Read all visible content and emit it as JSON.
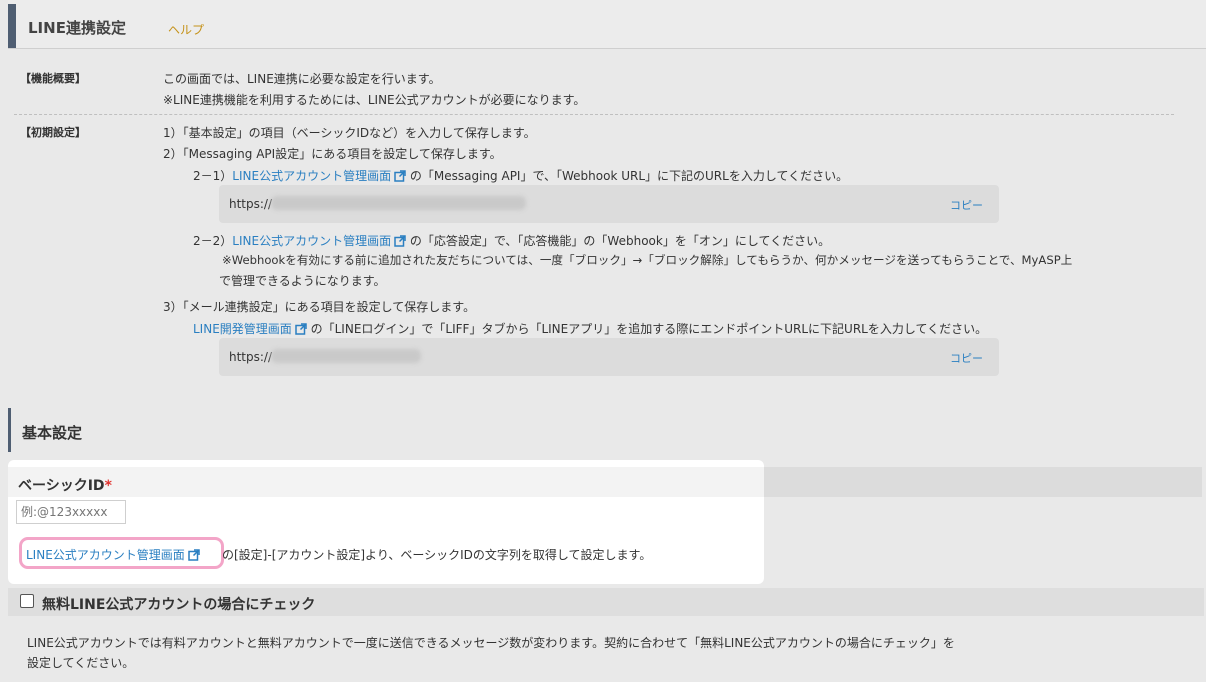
{
  "header": {
    "title": "LINE連携設定",
    "help": "ヘルプ"
  },
  "info": {
    "overview_label": "【機能概要】",
    "overview_lines": [
      "この画面では、LINE連携に必要な設定を行います。",
      "※LINE連携機能を利用するためには、LINE公式アカウントが必要になります。"
    ],
    "initial_label": "【初期設定】",
    "step1": "1）「基本設定」の項目（ベーシックIDなど）を入力して保存します。",
    "step2": "2）「Messaging API設定」にある項目を設定して保存します。",
    "step2_1_prefix": "2－1）",
    "step2_1_link": "LINE公式アカウント管理画面",
    "step2_1_text": "の「Messaging API」で、「Webhook URL」に下記のURLを入力してください。",
    "webhook_url": "https://",
    "copy": "コピー",
    "step2_2_prefix": "2－2）",
    "step2_2_link": "LINE公式アカウント管理画面",
    "step2_2_text": "の「応答設定」で、「応答機能」の「Webhook」を「オン」にしてください。",
    "step2_2_note1": "※Webhookを有効にする前に追加された友だちについては、一度「ブロック」→「ブロック解除」してもらうか、何かメッセージを送ってもらうことで、MyASP上",
    "step2_2_note2": "で管理できるようになります。",
    "step3": "3）「メール連携設定」にある項目を設定して保存します。",
    "step3_link": "LINE開発管理画面",
    "step3_text": "の「LINEログイン」で「LIFF」タブから「LINEアプリ」を追加する際にエンドポイントURLに下記URLを入力してください。",
    "liff_url": "https://",
    "copy2": "コピー"
  },
  "basic": {
    "section_title": "基本設定",
    "basic_id_label": "ベーシックID",
    "required_mark": "*",
    "basic_id_placeholder": "例:@123xxxxx",
    "account_link": "LINE公式アカウント管理画面",
    "account_desc": "の[設定]-[アカウント設定]より、ベーシックIDの文字列を取得して設定します。",
    "free_check_label": "無料LINE公式アカウントの場合にチェック",
    "note_line1": "LINE公式アカウントでは有料アカウントと無料アカウントで一度に送信できるメッセージ数が変わります。契約に合わせて「無料LINE公式アカウントの場合にチェック」を",
    "note_line2": "設定してください。"
  },
  "colors": {
    "accent_bar": "#4f5e72",
    "link": "#2a7fc1",
    "help": "#c5921a",
    "highlight": "#f3a5c8",
    "required": "#e0332f"
  }
}
